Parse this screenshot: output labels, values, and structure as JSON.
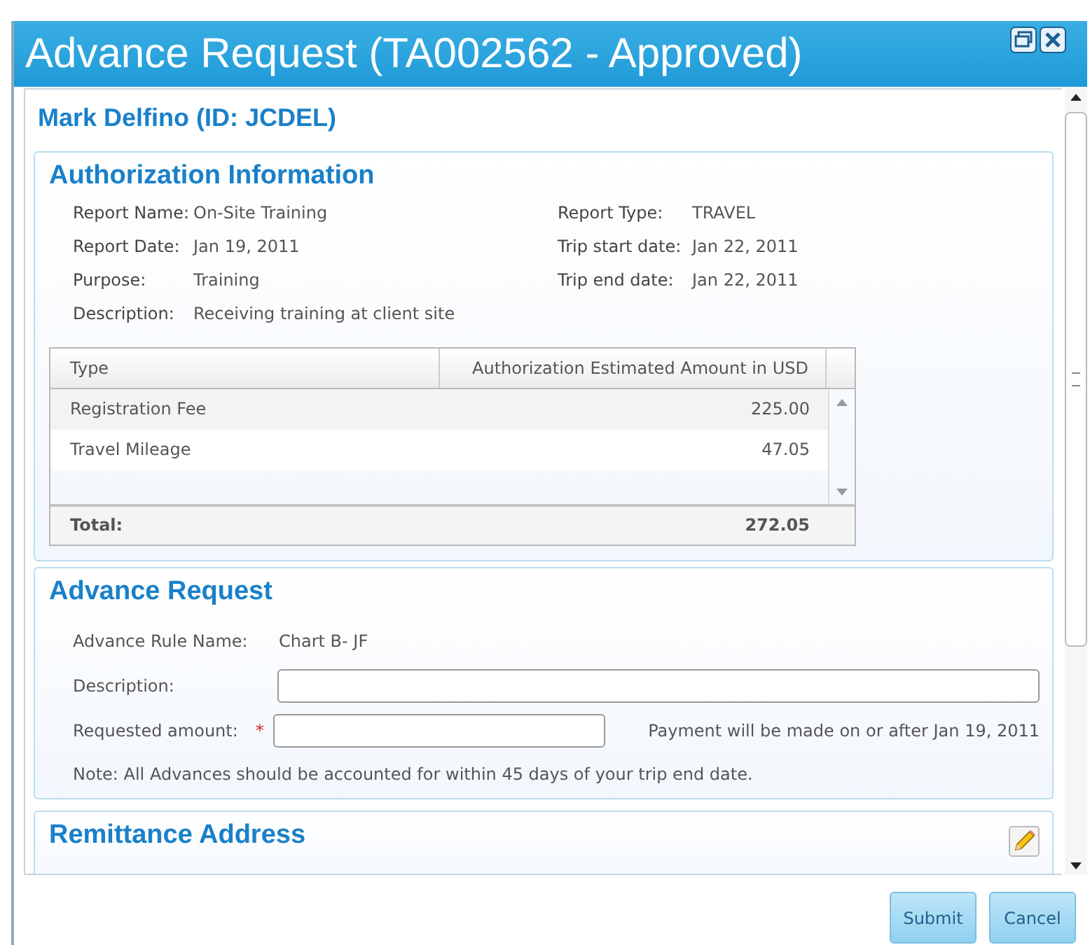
{
  "window": {
    "title": "Advance Request (TA002562 - Approved)"
  },
  "employee": "Mark Delfino (ID: JCDEL)",
  "authorization": {
    "title": "Authorization Information",
    "left_fields": [
      {
        "label": "Report Name:",
        "value": "On-Site Training"
      },
      {
        "label": "Report Date:",
        "value": "Jan 19, 2011"
      },
      {
        "label": "Purpose:",
        "value": "Training"
      },
      {
        "label": "Description:",
        "value": "Receiving training at client site"
      }
    ],
    "right_fields": [
      {
        "label": "Report Type:",
        "value": "TRAVEL"
      },
      {
        "label": "Trip start date:",
        "value": "Jan 22, 2011"
      },
      {
        "label": "Trip end date:",
        "value": "Jan 22, 2011"
      }
    ],
    "table": {
      "columns": [
        "Type",
        "Authorization Estimated Amount in USD"
      ],
      "rows": [
        [
          "Registration Fee",
          "225.00"
        ],
        [
          "Travel Mileage",
          "47.05"
        ]
      ],
      "total": {
        "label": "Total:",
        "value": "272.05"
      }
    }
  },
  "advance": {
    "title": "Advance Request",
    "rule": {
      "label": "Advance Rule Name:",
      "value": "Chart B- JF"
    },
    "description": {
      "label": "Description:"
    },
    "amount": {
      "label": "Requested amount:",
      "required_mark": "*",
      "hint": "Payment will be made on or after Jan 19, 2011"
    },
    "note": "Note: All Advances should be accounted for within 45 days of your trip end date."
  },
  "remittance": {
    "title": "Remittance Address"
  },
  "buttons": [
    "Submit",
    "Cancel"
  ]
}
